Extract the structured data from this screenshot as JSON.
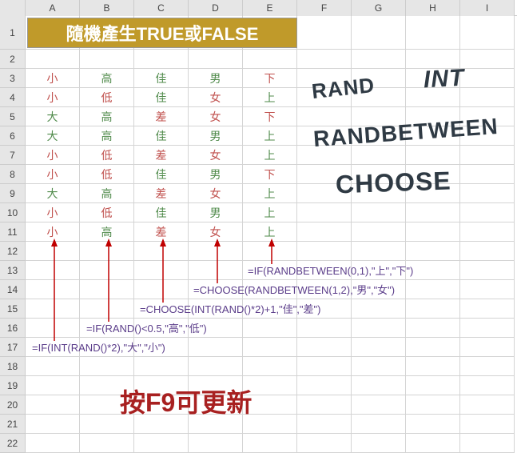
{
  "columns": [
    "A",
    "B",
    "C",
    "D",
    "E",
    "F",
    "G",
    "H",
    "I"
  ],
  "rows": [
    "1",
    "2",
    "3",
    "4",
    "5",
    "6",
    "7",
    "8",
    "9",
    "10",
    "11",
    "12",
    "13",
    "14",
    "15",
    "16",
    "17",
    "18",
    "19",
    "20",
    "21",
    "22"
  ],
  "banner": "隨機產生TRUE或FALSE",
  "data": {
    "r3": {
      "A": "小",
      "B": "高",
      "C": "佳",
      "D": "男",
      "E": "下",
      "Ac": "red",
      "Bc": "grn",
      "Cc": "grn",
      "Dc": "grn",
      "Ec": "red"
    },
    "r4": {
      "A": "小",
      "B": "低",
      "C": "佳",
      "D": "女",
      "E": "上",
      "Ac": "red",
      "Bc": "red",
      "Cc": "grn",
      "Dc": "red",
      "Ec": "grn"
    },
    "r5": {
      "A": "大",
      "B": "高",
      "C": "差",
      "D": "女",
      "E": "下",
      "Ac": "grn",
      "Bc": "grn",
      "Cc": "red",
      "Dc": "red",
      "Ec": "red"
    },
    "r6": {
      "A": "大",
      "B": "高",
      "C": "佳",
      "D": "男",
      "E": "上",
      "Ac": "grn",
      "Bc": "grn",
      "Cc": "grn",
      "Dc": "grn",
      "Ec": "grn"
    },
    "r7": {
      "A": "小",
      "B": "低",
      "C": "差",
      "D": "女",
      "E": "上",
      "Ac": "red",
      "Bc": "red",
      "Cc": "red",
      "Dc": "red",
      "Ec": "grn"
    },
    "r8": {
      "A": "小",
      "B": "低",
      "C": "佳",
      "D": "男",
      "E": "下",
      "Ac": "red",
      "Bc": "red",
      "Cc": "grn",
      "Dc": "grn",
      "Ec": "red"
    },
    "r9": {
      "A": "大",
      "B": "高",
      "C": "差",
      "D": "女",
      "E": "上",
      "Ac": "grn",
      "Bc": "grn",
      "Cc": "red",
      "Dc": "red",
      "Ec": "grn"
    },
    "r10": {
      "A": "小",
      "B": "低",
      "C": "佳",
      "D": "男",
      "E": "上",
      "Ac": "red",
      "Bc": "red",
      "Cc": "grn",
      "Dc": "grn",
      "Ec": "grn"
    },
    "r11": {
      "A": "小",
      "B": "高",
      "C": "差",
      "D": "女",
      "E": "上",
      "Ac": "red",
      "Bc": "grn",
      "Cc": "red",
      "Dc": "red",
      "Ec": "grn"
    }
  },
  "formulas": {
    "f13": "=IF(RANDBETWEEN(0,1),\"上\",\"下\")",
    "f14": "=CHOOSE(RANDBETWEEN(1,2),\"男\",\"女\")",
    "f15": "=CHOOSE(INT(RAND()*2)+1,\"佳\",\"差\")",
    "f16": "=IF(RAND()<0.5,\"高\",\"低\")",
    "f17": "=IF(INT(RAND()*2),\"大\",\"小\")"
  },
  "wordart": {
    "w1": "RAND",
    "w2": "INT",
    "w3": "RANDBETWEEN",
    "w4": "CHOOSE"
  },
  "refresh": "按F9可更新"
}
